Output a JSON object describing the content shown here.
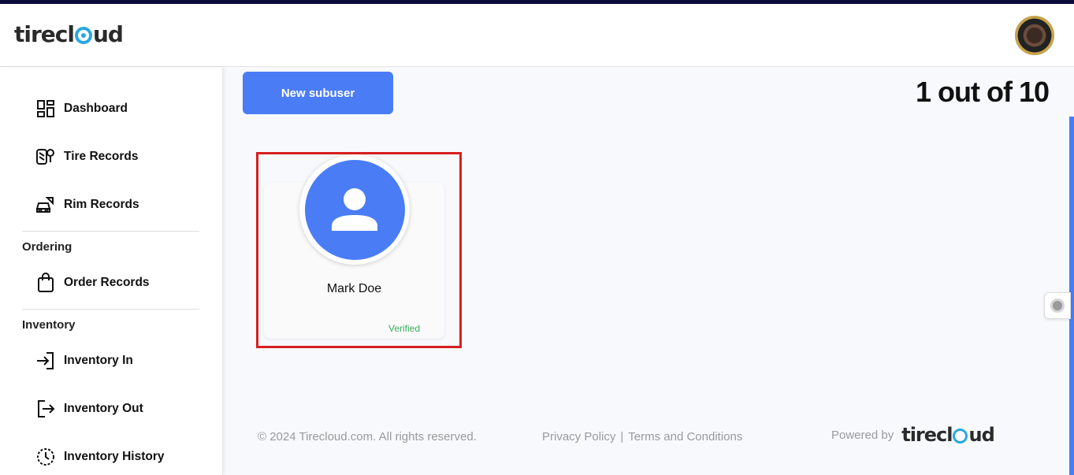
{
  "app": {
    "logo_text": "tirecloud"
  },
  "sidebar": {
    "items": [
      {
        "label": "Dashboard",
        "icon": "dashboard-icon"
      },
      {
        "label": "Tire Records",
        "icon": "tire-records-icon"
      },
      {
        "label": "Rim Records",
        "icon": "rim-records-icon"
      }
    ],
    "sections": [
      {
        "title": "Ordering",
        "items": [
          {
            "label": "Order Records",
            "icon": "shopping-bag-icon"
          }
        ]
      },
      {
        "title": "Inventory",
        "items": [
          {
            "label": "Inventory In",
            "icon": "login-arrow-icon"
          },
          {
            "label": "Inventory Out",
            "icon": "logout-arrow-icon"
          },
          {
            "label": "Inventory History",
            "icon": "history-clock-icon"
          }
        ]
      }
    ]
  },
  "main": {
    "new_button_label": "New subuser",
    "pager_text": "1 out of 10",
    "cards": [
      {
        "name": "Mark Doe",
        "status": "Verified",
        "status_color": "#3cab5e"
      }
    ]
  },
  "footer": {
    "copyright": "© 2024 Tirecloud.com. All rights reserved.",
    "privacy": "Privacy Policy",
    "separator": "|",
    "terms": "Terms and Conditions",
    "powered_by": "Powered by",
    "powered_logo": "tirecloud"
  },
  "colors": {
    "accent": "#4a7cf6",
    "highlight": "#d61f1f",
    "logo_blue": "#2aa8e0"
  }
}
